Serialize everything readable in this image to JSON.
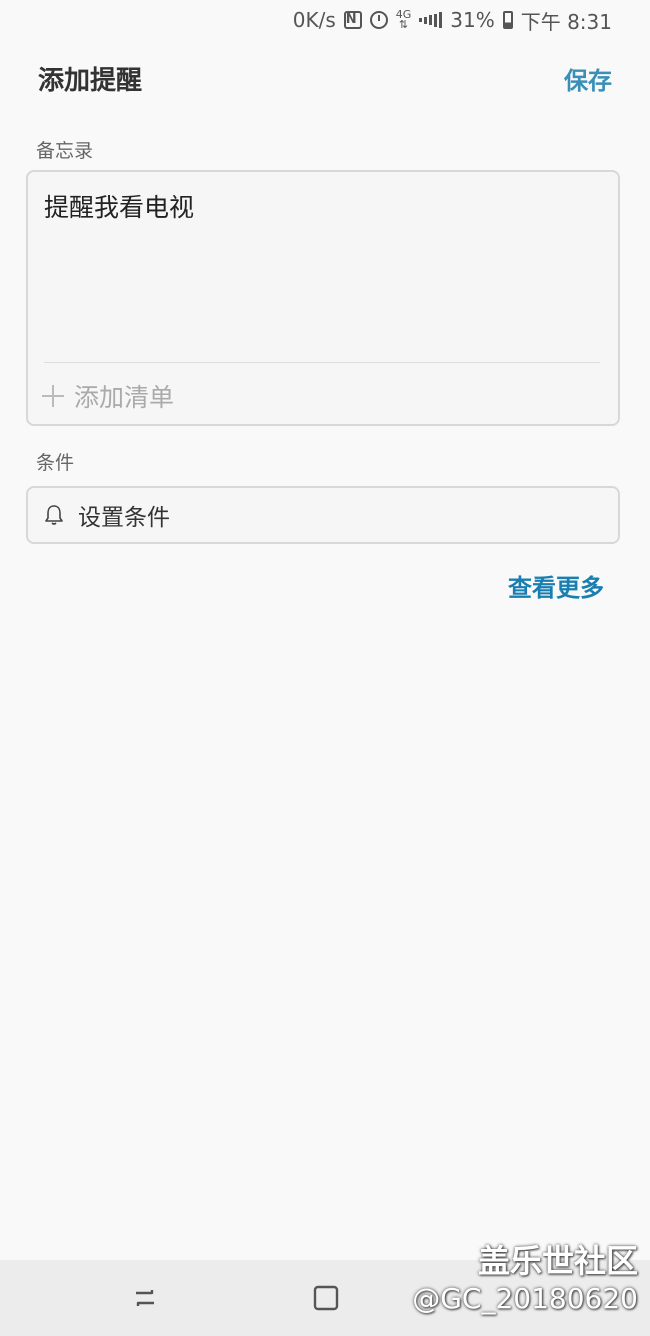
{
  "status_bar": {
    "speed": "0K/s",
    "network_type": "4G",
    "battery_percent": "31%",
    "battery_level": 0.31,
    "time": "下午 8:31",
    "icons": [
      "nfc-icon",
      "alarm-icon",
      "data-arrows-icon",
      "signal-icon",
      "battery-icon"
    ]
  },
  "header": {
    "title": "添加提醒",
    "save_label": "保存"
  },
  "memo": {
    "section_label": "备忘录",
    "text": "提醒我看电视",
    "add_list_label": "添加清单"
  },
  "condition": {
    "section_label": "条件",
    "set_condition_label": "设置条件"
  },
  "see_more_label": "查看更多",
  "watermark": {
    "title": "盖乐世社区",
    "user": "@GC_20180620"
  },
  "colors": {
    "accent": "#3a8fb7",
    "link": "#1a7fb0",
    "background": "#f9f9f9"
  }
}
